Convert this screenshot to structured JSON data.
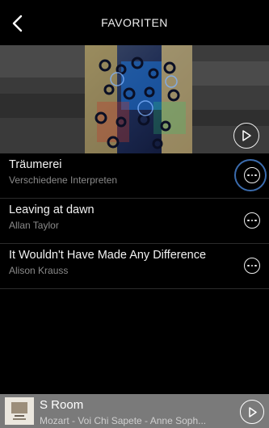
{
  "header": {
    "title": "FAVORITEN",
    "back_icon": "chevron-left-icon"
  },
  "artwork": {
    "play_icon": "play-circle-icon"
  },
  "tracks": [
    {
      "title": "Träumerei",
      "artist": "Verschiedene Interpreten",
      "highlighted": true
    },
    {
      "title": "Leaving at dawn",
      "artist": "Allan Taylor",
      "highlighted": false
    },
    {
      "title": "It Wouldn't Have Made Any Difference",
      "artist": "Alison Krauss",
      "highlighted": false
    }
  ],
  "mini_player": {
    "title": "S Room",
    "subtitle": "Mozart - Voi Chi Sapete - Anne Soph...",
    "play_icon": "play-circle-icon"
  },
  "colors": {
    "background": "#000000",
    "highlight_ring": "#3b6cae",
    "mini_player_bg": "#7a7a7a"
  }
}
